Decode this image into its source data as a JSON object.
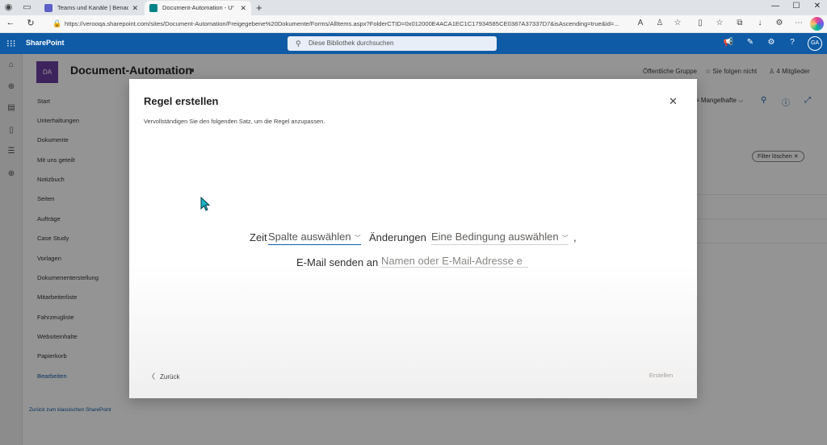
{
  "browser": {
    "tabs": [
      {
        "label": "Teams und Kanäle | Benachrichtigungen"
      },
      {
        "label": "Document-Automation - UVV-Prüfung"
      }
    ],
    "url": "https://verooqa.sharepoint.com/sites/Document-Automation/Freigegebene%20Dokumente/Forms/AllItems.aspx?FolderCTID=0x012000E4ACA1EC1C17934585CE0387A37337D7&isAscending=true&id=..."
  },
  "sharepoint": {
    "app_name": "SharePoint",
    "search_placeholder": "Diese Bibliothek durchsuchen",
    "avatar": "GA"
  },
  "site": {
    "logo": "DA",
    "title": "Document-Automation",
    "group": "Öffentliche Gruppe",
    "follow": "Sie folgen nicht",
    "members": "4 Mitglieder"
  },
  "nav": {
    "items": [
      "Start",
      "Unterhaltungen",
      "Dokumente",
      "Mit uns geteilt",
      "Notizbuch",
      "Seiten",
      "Aufträge",
      "Case Study",
      "Vorlagen",
      "Dokumenenterstellung",
      "Mitarbeiterliste",
      "Fahrzeugliste",
      "Websiteinhalte",
      "Papierkorb"
    ],
    "edit": "Bearbeiten",
    "classic_link": "Zurück zum klassischen SharePoint"
  },
  "content": {
    "view": "Mangelhafte",
    "filter_clear": "Filter löschen"
  },
  "dialog": {
    "title": "Regel erstellen",
    "subtitle": "Vervollständigen Sie den folgenden Satz, um die Regel anzupassen.",
    "word_time": "Zeit",
    "column_select": "Spalte auswählen",
    "word_changes": "Änderungen",
    "condition_select": "Eine Bedingung auswählen",
    "comma": ",",
    "send_email": "E-Mail senden an",
    "email_placeholder": "Namen oder E-Mail-Adresse e",
    "back": "Zurück",
    "create": "Erstellen"
  }
}
